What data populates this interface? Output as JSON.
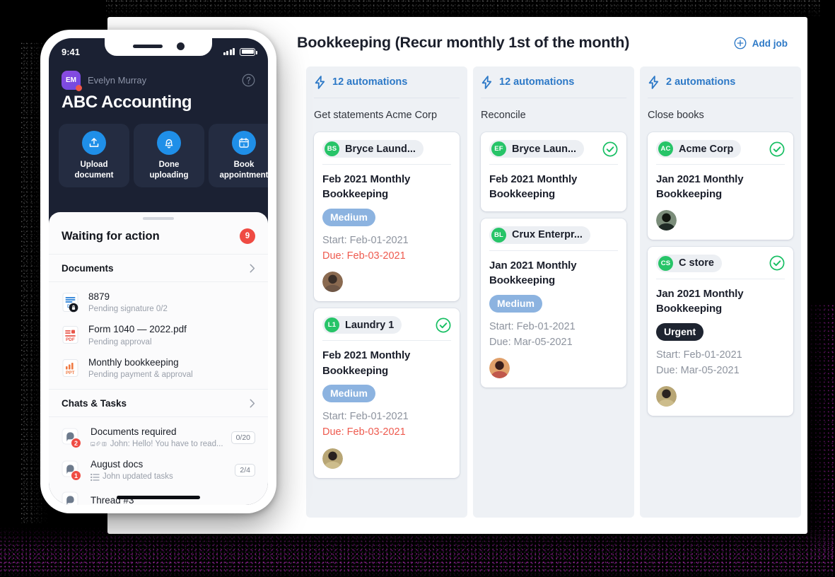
{
  "panel": {
    "title": "Bookkeeping (Recur monthly 1st of the month)",
    "add_job_label": "Add job",
    "accent_blue": "#2d79c7"
  },
  "board": {
    "columns": [
      {
        "automations_label": "12 automations",
        "name": "Get statements Acme Corp",
        "cards": [
          {
            "client_initials": "BS",
            "client_name": "Bryce Laund...",
            "done": false,
            "title": "Feb 2021 Monthly Bookkeeping",
            "priority": "Medium",
            "priority_kind": "medium",
            "start": "Start: Feb-01-2021",
            "due": "Due: Feb-03-2021",
            "due_overdue": true,
            "avatar_colors": [
              "#6f5746",
              "#3b2f28",
              "#8a6a50"
            ]
          },
          {
            "client_initials": "L1",
            "client_name": "Laundry 1",
            "done": true,
            "title": "Feb 2021 Monthly Bookkeeping",
            "priority": "Medium",
            "priority_kind": "medium",
            "start": "Start: Feb-01-2021",
            "due": "Due: Feb-03-2021",
            "due_overdue": true,
            "avatar_colors": [
              "#cdbd8c",
              "#2a2320",
              "#b8a675"
            ]
          }
        ]
      },
      {
        "automations_label": "12 automations",
        "name": "Reconcile",
        "cards": [
          {
            "client_initials": "EF",
            "client_name": "Bryce Laun...",
            "done": true,
            "title": "Feb 2021 Monthly Bookkeeping",
            "priority": "",
            "priority_kind": "",
            "start": "",
            "due": "",
            "due_overdue": false,
            "avatar_colors": []
          },
          {
            "client_initials": "BL",
            "client_name": "Crux Enterpr...",
            "done": false,
            "title": "Jan 2021 Monthly Bookkeeping",
            "priority": "Medium",
            "priority_kind": "medium",
            "start": "Start: Feb-01-2021",
            "due": "Due: Mar-05-2021",
            "due_overdue": false,
            "avatar_colors": [
              "#c0584c",
              "#3a1f1c",
              "#e0a06a"
            ]
          }
        ]
      },
      {
        "automations_label": "2 automations",
        "name": "Close books",
        "cards": [
          {
            "client_initials": "AC",
            "client_name": "Acme Corp",
            "done": true,
            "title": "Jan 2021 Monthly Bookkeeping",
            "priority": "",
            "priority_kind": "",
            "start": "",
            "due": "",
            "due_overdue": false,
            "avatar_colors": [
              "#1f2b26",
              "#10150f",
              "#7b8d7a"
            ]
          },
          {
            "client_initials": "CS",
            "client_name": "C store",
            "done": true,
            "title": "Jan 2021 Monthly Bookkeeping",
            "priority": "Urgent",
            "priority_kind": "urgent",
            "start": "Start: Feb-01-2021",
            "due": "Due: Mar-05-2021",
            "due_overdue": false,
            "avatar_colors": [
              "#cdbd8c",
              "#2a2320",
              "#b8a675"
            ]
          }
        ]
      }
    ]
  },
  "phone": {
    "status": {
      "time": "9:41"
    },
    "user": {
      "initials": "EM",
      "name": "Evelyn Murray"
    },
    "org": "ABC Accounting",
    "quick_actions": [
      {
        "icon": "upload-icon",
        "line1": "Upload",
        "line2": "document"
      },
      {
        "icon": "bell-check-icon",
        "line1": "Done",
        "line2": "uploading"
      },
      {
        "icon": "calendar-icon",
        "line1": "Book",
        "line2": "appointment"
      }
    ],
    "sheet": {
      "title": "Waiting for action",
      "count": "9"
    },
    "documents": {
      "section_label": "Documents",
      "items": [
        {
          "icon": "doc-icon",
          "name": "8879",
          "sub": "Pending signature 0/2"
        },
        {
          "icon": "pdf-icon",
          "name": "Form 1040 — 2022.pdf",
          "sub": "Pending approval"
        },
        {
          "icon": "ppt-icon",
          "name": "Monthly bookkeeping",
          "sub": "Pending payment & approval"
        }
      ]
    },
    "chats": {
      "section_label": "Chats & Tasks",
      "items": [
        {
          "name": "Documents required",
          "sub": "John: Hello! You have to read...",
          "badge": "2",
          "count": "0/20",
          "icons": "img-clip-grid"
        },
        {
          "name": "August docs",
          "sub": "John updated tasks",
          "badge": "1",
          "count": "2/4",
          "icons": "list"
        },
        {
          "name": "Thread #3",
          "sub": "",
          "badge": "",
          "count": "",
          "icons": ""
        }
      ]
    }
  }
}
